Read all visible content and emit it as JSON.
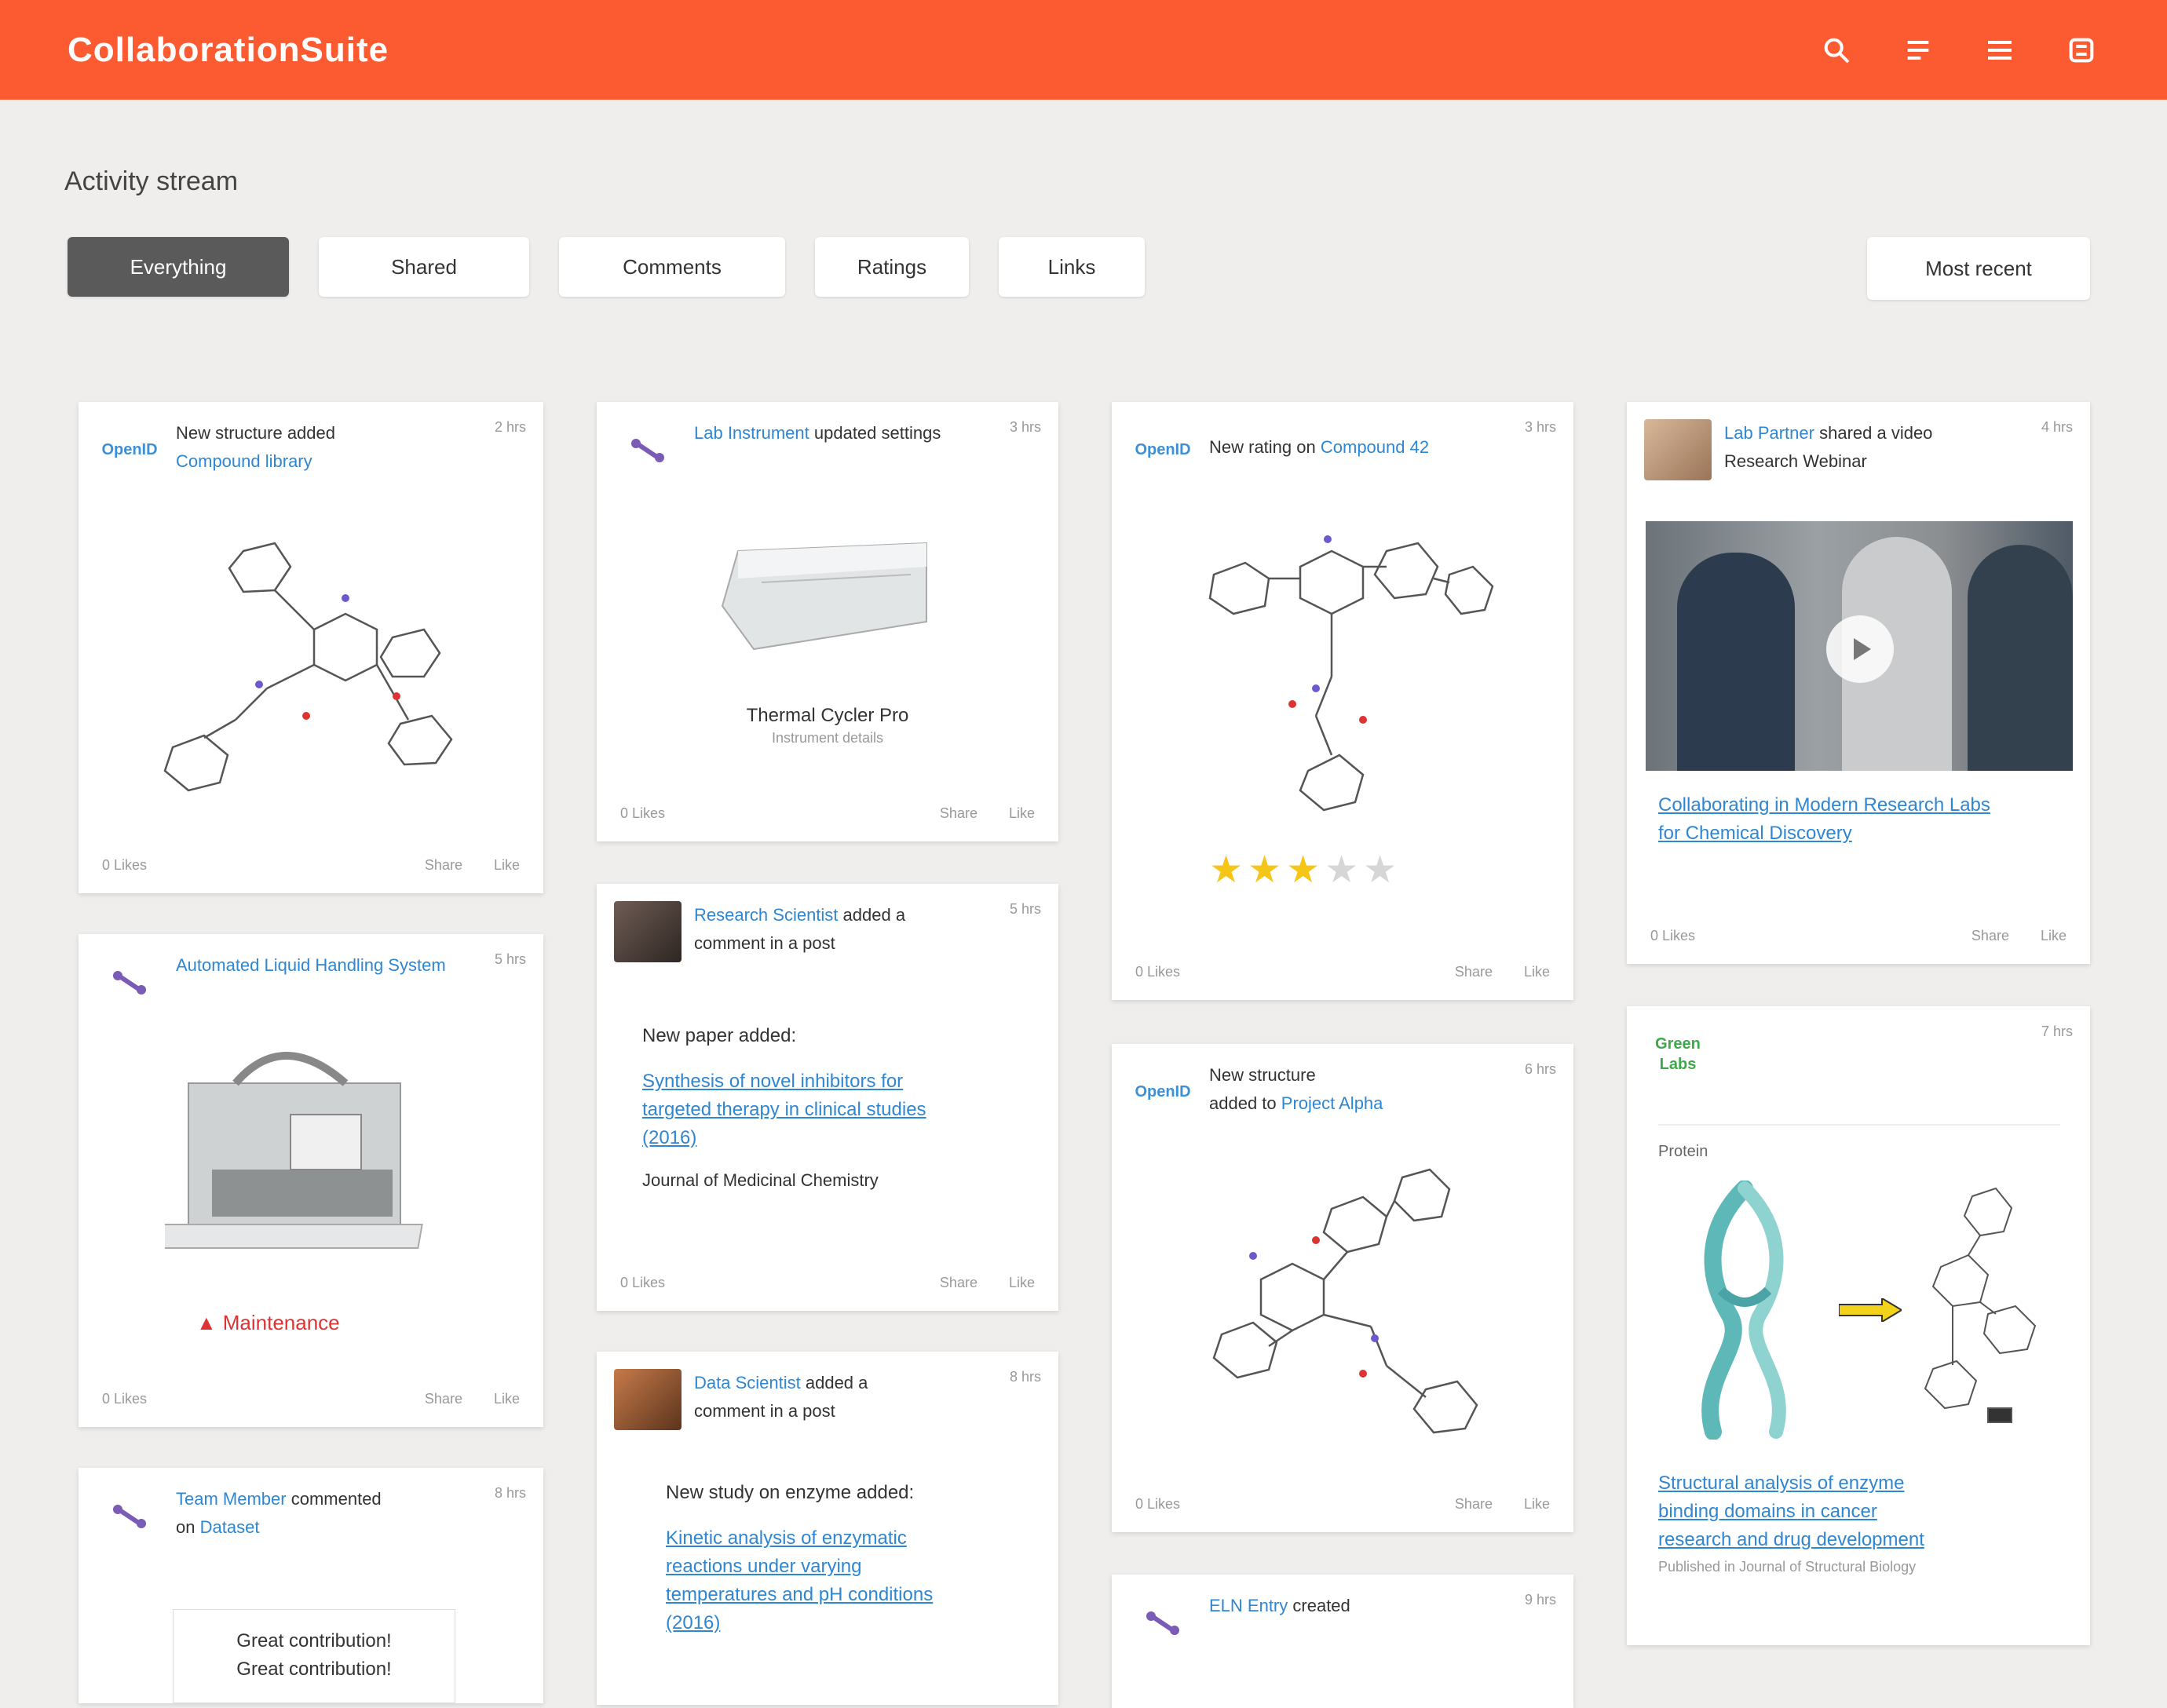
{
  "app": {
    "title": "CollaborationSuite"
  },
  "page": {
    "title": "Activity stream"
  },
  "filters": [
    "Everything",
    "Shared",
    "Comments",
    "Ratings",
    "Links"
  ],
  "sort_label": "Most recent",
  "cards": {
    "c1": {
      "logo": "OpenID",
      "head": "New structure added",
      "head_link": "Compound library",
      "time": "2 hrs",
      "foot_left": "0 Likes",
      "foot_a": "Share",
      "foot_b": "Like"
    },
    "c2": {
      "head_link": "Lab Instrument",
      "head": "updated settings",
      "time": "3 hrs",
      "caption": "Thermal Cycler Pro",
      "subcaption": "Instrument details",
      "foot_left": "0 Likes",
      "foot_a": "Share",
      "foot_b": "Like"
    },
    "c3": {
      "logo": "OpenID",
      "head": "New rating on",
      "head_link": "Compound 42",
      "time": "3 hrs",
      "foot_left": "0 Likes",
      "foot_a": "Share",
      "foot_b": "Like",
      "rating": 3,
      "max_rating": 5
    },
    "c4": {
      "head_link": "Lab Partner",
      "head": "shared a video",
      "head2": "Research Webinar",
      "time": "4 hrs",
      "link": "Collaborating in Modern Research Labs",
      "link2": "for Chemical Discovery",
      "foot_left": "0 Likes",
      "foot_a": "Share",
      "foot_b": "Like"
    },
    "c5": {
      "head_link": "Automated Liquid Handling System",
      "time": "5 hrs",
      "badge": "Maintenance",
      "foot_left": "0 Likes",
      "foot_a": "Share",
      "foot_b": "Like"
    },
    "c6": {
      "head_link": "Research Scientist",
      "head": "added a",
      "head2": "comment in a post",
      "time": "5 hrs",
      "text": "New paper added:",
      "link": "Synthesis of novel inhibitors for",
      "link2": "targeted therapy in clinical studies",
      "link3": "(2016)",
      "text2": "Journal of Medicinal Chemistry",
      "foot_left": "0 Likes",
      "foot_a": "Share",
      "foot_b": "Like"
    },
    "c7": {
      "logo": "OpenID",
      "head": "New structure",
      "head2": "added to",
      "head_link": "Project Alpha",
      "time": "6 hrs",
      "foot_left": "0 Likes",
      "foot_a": "Share",
      "foot_b": "Like"
    },
    "c8": {
      "logo1": "Green",
      "logo2": "Labs",
      "time": "7 hrs",
      "label": "Protein",
      "link": "Structural analysis of enzyme",
      "link2": "binding domains in cancer",
      "link3": "research and drug development",
      "foot_text": "Published in Journal of Structural Biology",
      "foot_left": "",
      "foot_a": "",
      "foot_b": ""
    },
    "c9": {
      "head_link": "Team Member",
      "head": "commented",
      "head2": "on",
      "head_link2": "Dataset",
      "time": "8 hrs",
      "text": "Great contribution!",
      "text2": "Great contribution!"
    },
    "c10": {
      "head_link": "Data Scientist",
      "head": "added a",
      "head2": "comment in a post",
      "time": "8 hrs",
      "text": "New study on enzyme added:",
      "link": "Kinetic analysis of enzymatic",
      "link2": "reactions under varying",
      "link3": "temperatures and pH conditions",
      "link4": "(2016)"
    },
    "c11": {
      "head_link": "ELN Entry",
      "head": "created",
      "time": "9 hrs"
    }
  },
  "colors": {
    "brand": "#fc5b32",
    "link": "#2f86d1",
    "star": "#f5c518"
  },
  "icons": [
    "search-icon",
    "list-icon",
    "menu-icon",
    "settings-icon"
  ]
}
